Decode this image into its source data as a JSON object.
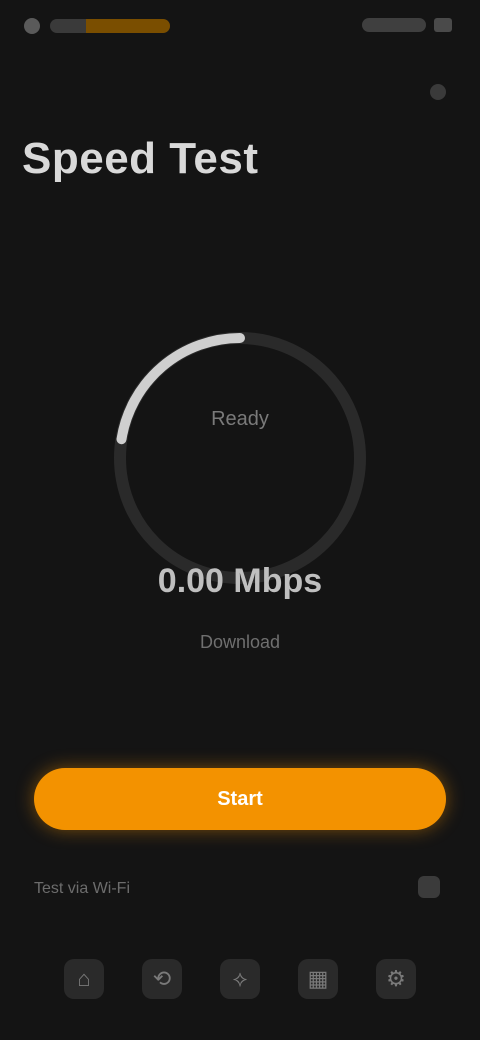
{
  "status_bar": {
    "left_icon": "dot-icon",
    "brand_icon": "brand-logo-icon",
    "right_icons": [
      "wifi-icon",
      "battery-icon"
    ]
  },
  "header": {
    "title": "Speed Test"
  },
  "gauge": {
    "label": "Ready",
    "arc_fraction": 0.5,
    "colors": {
      "track": "#2a2a2a",
      "arc": "#cfcfcf"
    }
  },
  "readout": {
    "speed": "0.00 Mbps",
    "subinfo": "Download"
  },
  "actions": {
    "start_label": "Start"
  },
  "hint": {
    "text": "Test via Wi‑Fi"
  },
  "bottom_nav": {
    "items": [
      {
        "name": "nav-home",
        "icon": "home-icon",
        "glyph": "⌂"
      },
      {
        "name": "nav-history",
        "icon": "history-icon",
        "glyph": "⟲"
      },
      {
        "name": "nav-test",
        "icon": "speed-icon",
        "glyph": "⟡"
      },
      {
        "name": "nav-stats",
        "icon": "chart-icon",
        "glyph": "▦"
      },
      {
        "name": "nav-settings",
        "icon": "settings-icon",
        "glyph": "⚙"
      }
    ]
  }
}
